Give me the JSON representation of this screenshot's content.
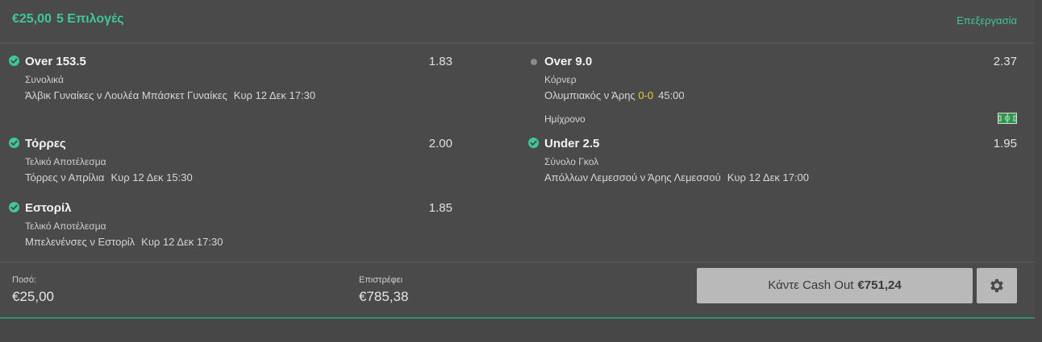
{
  "header": {
    "stake_title": "€25,00",
    "selections_count": "5 Επιλογές",
    "edit_label": "Επεξεργασία"
  },
  "selections": [
    {
      "status": "won",
      "name": "Over 153.5",
      "odds": "1.83",
      "market": "Συνολικά",
      "event": "Άλβικ Γυναίκες ν Λουλέα Μπάσκετ Γυναίκες",
      "time": "Κυρ 12 Δεκ 17:30"
    },
    {
      "status": "won",
      "name": "Τόρρες",
      "odds": "2.00",
      "market": "Τελικό Αποτέλεσμα",
      "event": "Τόρρες ν Απρίλια",
      "time": "Κυρ 12 Δεκ 15:30"
    },
    {
      "status": "won",
      "name": "Εστορίλ",
      "odds": "1.85",
      "market": "Τελικό Αποτέλεσμα",
      "event": "Μπελενένσες ν Εστορίλ",
      "time": "Κυρ 12 Δεκ 17:30"
    },
    {
      "status": "pending",
      "name": "Over 9.0",
      "odds": "2.37",
      "market": "Κόρνερ",
      "event": "Ολυμπιακός ν Άρης",
      "score": "0-0",
      "clock": "45:00",
      "period": "Ημίχρονο",
      "live_icon": "football-pitch-icon"
    },
    {
      "status": "won",
      "name": "Under 2.5",
      "odds": "1.95",
      "market": "Σύνολο Γκολ",
      "event": "Απόλλων Λεμεσσού ν Άρης Λεμεσσού",
      "time": "Κυρ 12 Δεκ 17:00"
    }
  ],
  "footer": {
    "stake_label": "Ποσό:",
    "stake_value": "€25,00",
    "returns_label": "Επιστρέφει",
    "returns_value": "€785,38",
    "cashout_label": "Κάντε Cash Out",
    "cashout_amount": "€751,24",
    "settings_icon": "gear-icon"
  },
  "colors": {
    "accent": "#3fc69a",
    "background": "#4a4a4a",
    "score": "#f2cf30",
    "button": "#b9b9b9"
  }
}
